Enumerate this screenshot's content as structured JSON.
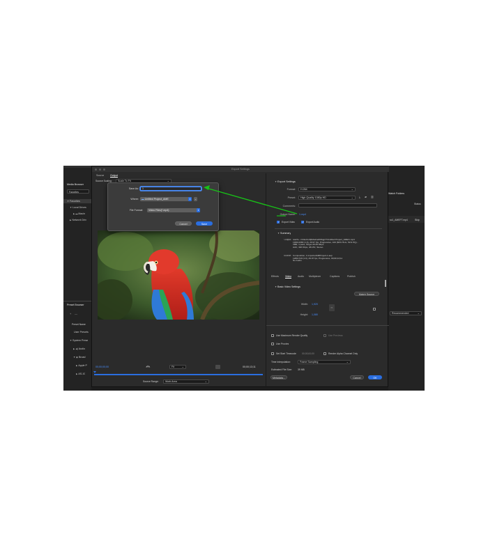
{
  "colors": {
    "accent": "#2a6ee0",
    "link": "#4a8fff",
    "annotation_arrow": "#18c018"
  },
  "left_panel": {
    "tabs": [
      "Media Browser",
      "≡"
    ],
    "favorites_dropdown": "Favorites",
    "tree": [
      "Favorites",
      "Local Drives",
      "Macin",
      "Network Driv"
    ],
    "preset_browser": "Preset Browser",
    "preset_name_header": "Preset Name",
    "preset_items": [
      "User Presets",
      "System Prese",
      "Audio",
      "Broad",
      "Apple P",
      "AS-10"
    ]
  },
  "right_strip": {
    "watch_folders": "Watch Folders",
    "status_header": "Status",
    "file_name": "sc1_AMEFT.mp4",
    "file_status": "Skip",
    "recommended": "Recommended"
  },
  "export_dialog": {
    "title": "Export Settings",
    "tabs": {
      "source": "Source",
      "output": "Output"
    },
    "source_scaling_label": "Source Scaling:",
    "source_scaling_value": "Scale To Fit",
    "timecode_start": "00;00;00;00",
    "timecode_end": "00;00;13;11",
    "fit_label": "Fit",
    "source_range_label": "Source Range:",
    "source_range_value": "Work Area",
    "export_settings": {
      "header": "Export Settings",
      "format_label": "Format:",
      "format_value": "H.264",
      "preset_label": "Preset:",
      "preset_value": "High Quality 1080p HD",
      "comments_label": "Comments:",
      "output_name_label": "Output Name:",
      "output_name_value": "1.mp4",
      "export_video": "Export Video",
      "export_audio": "Export Audio"
    },
    "summary": {
      "header": "Summary",
      "output_label": "Output:",
      "output_lines": [
        "/var/fo...r/4nkxbxr0j9dwlca203lqgr/T/Untitled Project_AME/1.mp4",
        "1920x1080 (1.0), 29.97 fps, Progressive, 100 (60% HLG, 51% PQ)...",
        "VBR, 1 pass, Target 20.00 Mbps",
        "AAC, 320 Kbps, 48 kHz, Stereo"
      ],
      "source_label": "Source:",
      "source_lines": [
        "Composition, 1.ImportedAMProject-1.aep",
        "1280x720 (1.0), 29.97 fps, Progressive, 00;00;13;11",
        "No Audio"
      ]
    },
    "settings_tabs": [
      "Effects",
      "Video",
      "Audio",
      "Multiplexer",
      "Captions",
      "Publish"
    ],
    "basic_video_settings": "Basic Video Settings",
    "match_source": "Match Source",
    "width_label": "Width:",
    "width_value": "1,920",
    "height_label": "Height:",
    "height_value": "1,080",
    "use_max_render_quality": "Use Maximum Render Quality",
    "use_previews": "Use Previews",
    "use_proxies": "Use Proxies",
    "set_start_timecode": "Set Start Timecode",
    "start_timecode_value": "00;00;00;00",
    "render_alpha": "Render Alpha Channel Only",
    "time_interpolation_label": "Time Interpolation:",
    "time_interpolation_value": "Frame Sampling",
    "estimated_file_size_label": "Estimated File Size:",
    "estimated_file_size_value": "39 MB",
    "metadata_button": "Metadata...",
    "cancel_button": "Cancel",
    "ok_button": "OK"
  },
  "save_dialog": {
    "save_as_label": "Save As:",
    "save_as_value": "1",
    "where_label": "Where:",
    "where_value": "Untitled Project_AME",
    "file_format_label": "File Format:",
    "file_format_value": "Video Files(*.mp4)",
    "cancel_button": "Cancel",
    "save_button": "Save"
  }
}
